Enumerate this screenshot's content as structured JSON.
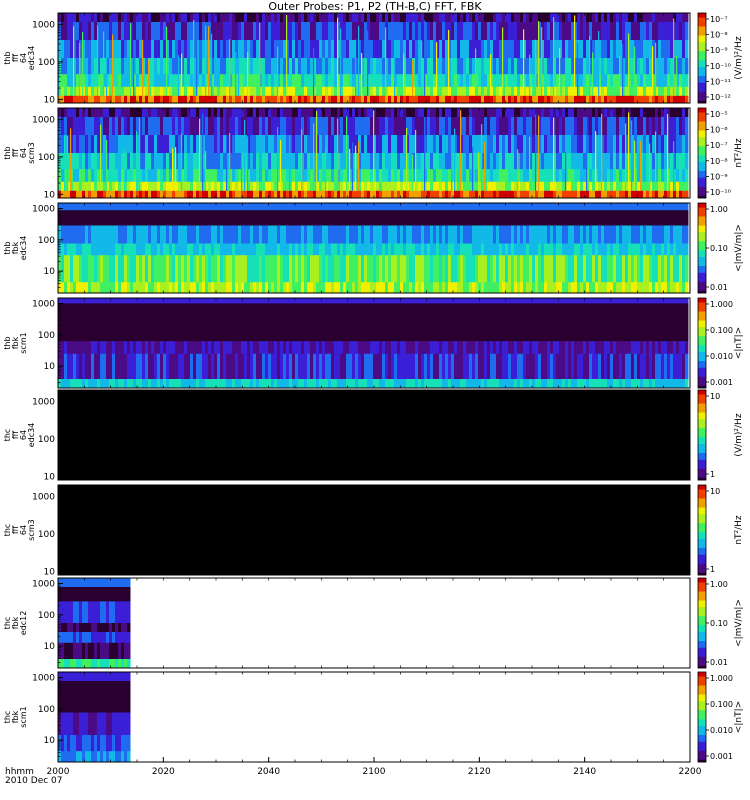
{
  "title": "Outer Probes: P1, P2 (TH-B,C) FFT, FBK",
  "time_axis": {
    "row1": "hhmm",
    "row2": "2010 Dec 07",
    "ticks": [
      "2000",
      "2020",
      "2040",
      "2100",
      "2120",
      "2140",
      "2200"
    ]
  },
  "colors": {
    "background": "#ffffff",
    "empty_fill": "#000000",
    "colormap": [
      "#2a0030",
      "#4b0a86",
      "#3a1fd6",
      "#1f6cf0",
      "#12b8e8",
      "#16e0b8",
      "#40f060",
      "#a8f020",
      "#f0f000",
      "#f0a000",
      "#f04000",
      "#d00000"
    ]
  },
  "chart_data": [
    {
      "type": "heatmap",
      "label": [
        "thb",
        "fff",
        "64",
        "edc34"
      ],
      "ylim": [
        8,
        2000
      ],
      "ylog": true,
      "yticks": [
        "1000",
        "100",
        "10"
      ],
      "coverage": [
        0,
        1
      ],
      "colorbar": {
        "unit": "(V/m)²/Hz",
        "ticks": [
          "10⁻⁷",
          "10⁻⁸",
          "10⁻⁹",
          "10⁻¹⁰",
          "10⁻¹¹",
          "10⁻¹²"
        ]
      }
    },
    {
      "type": "heatmap",
      "label": [
        "thb",
        "fff",
        "64",
        "scm3"
      ],
      "ylim": [
        8,
        2000
      ],
      "ylog": true,
      "yticks": [
        "1000",
        "100",
        "10"
      ],
      "coverage": [
        0,
        1
      ],
      "colorbar": {
        "unit": "nT²/Hz",
        "ticks": [
          "10⁻⁵",
          "10⁻⁶",
          "10⁻⁷",
          "10⁻⁸",
          "10⁻⁹",
          "10⁻¹⁰"
        ]
      }
    },
    {
      "type": "heatmap",
      "label": [
        "thb",
        "fbk",
        "edc34"
      ],
      "ylim": [
        2,
        1500
      ],
      "ylog": true,
      "yticks": [
        "1000",
        "100",
        "10"
      ],
      "coverage": [
        0,
        1
      ],
      "colorbar": {
        "unit": "<|mV/m|>",
        "ticks": [
          "1.00",
          "0.10",
          "0.01"
        ]
      }
    },
    {
      "type": "heatmap",
      "label": [
        "thb",
        "fbk",
        "scm1"
      ],
      "ylim": [
        2,
        1500
      ],
      "ylog": true,
      "yticks": [
        "1000",
        "100",
        "10"
      ],
      "coverage": [
        0,
        1
      ],
      "colorbar": {
        "unit": "<|nT|>",
        "ticks": [
          "1.000",
          "0.100",
          "0.010",
          "0.001"
        ]
      }
    },
    {
      "type": "heatmap",
      "label": [
        "thc",
        "fff",
        "64",
        "edc34"
      ],
      "ylim": [
        8,
        2000
      ],
      "ylog": true,
      "yticks": [
        "1000",
        "100",
        "10"
      ],
      "coverage": [
        0,
        1
      ],
      "note": "no data (filled black)",
      "colorbar": {
        "unit": "(V/m)²/Hz",
        "ticks": [
          "10",
          "1"
        ]
      }
    },
    {
      "type": "heatmap",
      "label": [
        "thc",
        "fff",
        "64",
        "scm3"
      ],
      "ylim": [
        8,
        2000
      ],
      "ylog": true,
      "yticks": [
        "1000",
        "100",
        "10"
      ],
      "coverage": [
        0,
        1
      ],
      "note": "no data (filled black)",
      "colorbar": {
        "unit": "nT²/Hz",
        "ticks": [
          "10",
          "1"
        ]
      }
    },
    {
      "type": "heatmap",
      "label": [
        "thc",
        "fbk",
        "edc12"
      ],
      "ylim": [
        2,
        1500
      ],
      "ylog": true,
      "yticks": [
        "1000",
        "100",
        "10"
      ],
      "coverage": [
        0,
        0.117
      ],
      "colorbar": {
        "unit": "<|mV/m|>",
        "ticks": [
          "1.00",
          "0.10",
          "0.01"
        ]
      }
    },
    {
      "type": "heatmap",
      "label": [
        "thc",
        "fbk",
        "scm1"
      ],
      "ylim": [
        2,
        1500
      ],
      "ylog": true,
      "yticks": [
        "1000",
        "100",
        "10"
      ],
      "coverage": [
        0,
        0.117
      ],
      "colorbar": {
        "unit": "<|nT|>",
        "ticks": [
          "1.000",
          "0.100",
          "0.010",
          "0.001"
        ]
      }
    }
  ]
}
